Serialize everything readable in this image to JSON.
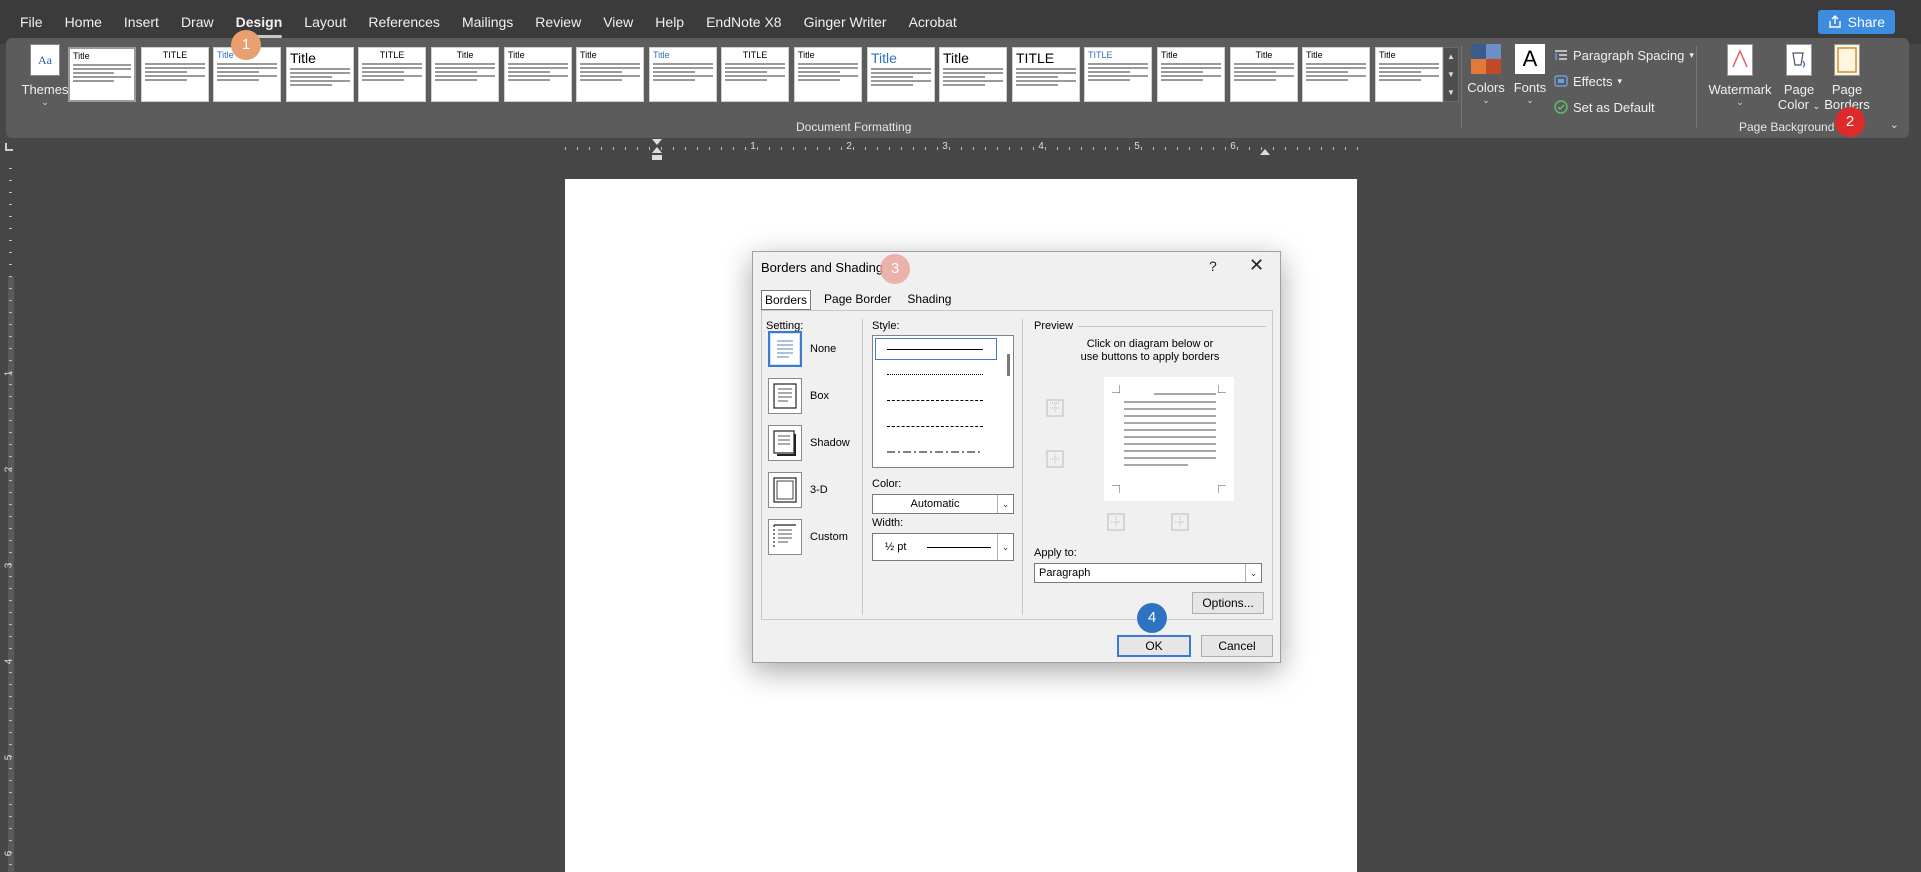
{
  "menu": {
    "items": [
      "File",
      "Home",
      "Insert",
      "Draw",
      "Design",
      "Layout",
      "References",
      "Mailings",
      "Review",
      "View",
      "Help",
      "EndNote X8",
      "Ginger Writer",
      "Acrobat"
    ],
    "active": "Design",
    "share_label": "Share"
  },
  "ribbon": {
    "themes_label": "Themes",
    "style_thumbnails": [
      {
        "title": "Title",
        "kind": "plain"
      },
      {
        "title": "TITLE",
        "kind": "caps"
      },
      {
        "title": "Title",
        "kind": "blue"
      },
      {
        "title": "Title",
        "kind": "big"
      },
      {
        "title": "TITLE",
        "kind": "caps"
      },
      {
        "title": "Title",
        "kind": "center"
      },
      {
        "title": "Title",
        "kind": "plain"
      },
      {
        "title": "Title",
        "kind": "plain"
      },
      {
        "title": "Title",
        "kind": "blue"
      },
      {
        "title": "TITLE",
        "kind": "caps"
      },
      {
        "title": "Title",
        "kind": "plain"
      },
      {
        "title": "Title",
        "kind": "bigblue"
      },
      {
        "title": "Title",
        "kind": "big"
      },
      {
        "title": "TITLE",
        "kind": "bigcaps"
      },
      {
        "title": "TITLE",
        "kind": "blue"
      },
      {
        "title": "Title",
        "kind": "plain"
      },
      {
        "title": "Title",
        "kind": "center"
      },
      {
        "title": "Title",
        "kind": "plain"
      },
      {
        "title": "Title",
        "kind": "plain"
      }
    ],
    "group_document_formatting": "Document Formatting",
    "colors_label": "Colors",
    "fonts_label": "Fonts",
    "paragraph_spacing_label": "Paragraph Spacing",
    "effects_label": "Effects",
    "set_as_default_label": "Set as Default",
    "watermark_label": "Watermark",
    "page_color_label": [
      "Page",
      "Color"
    ],
    "page_borders_label": [
      "Page",
      "Borders"
    ],
    "group_page_background": "Page Background"
  },
  "badges": [
    "1",
    "2",
    "3",
    "4"
  ],
  "ruler": {
    "h_numbers": [
      "1",
      "2",
      "3",
      "4",
      "5",
      "6"
    ],
    "v_numbers": [
      "1",
      "2",
      "3",
      "4",
      "5",
      "6"
    ]
  },
  "dialog": {
    "title": "Borders and Shading",
    "help": "?",
    "close": "✕",
    "tabs": [
      "Borders",
      "Page Border",
      "Shading"
    ],
    "active_tab": "Borders",
    "setting_label": "Setting:",
    "settings": [
      "None",
      "Box",
      "Shadow",
      "3-D",
      "Custom"
    ],
    "selected_setting": "None",
    "style_label": "Style:",
    "color_label": "Color:",
    "color_value": "Automatic",
    "width_label": "Width:",
    "width_value": "½ pt",
    "preview_label": "Preview",
    "preview_hint": [
      "Click on diagram below or",
      "use buttons to apply borders"
    ],
    "apply_to_label": "Apply to:",
    "apply_to_value": "Paragraph",
    "options_label": "Options...",
    "ok_label": "OK",
    "cancel_label": "Cancel"
  },
  "colors": {
    "accent": "#3a7ad0",
    "badge_1": "#e8a070",
    "badge_2": "#e02a2a",
    "badge_4": "#2d73c2"
  }
}
